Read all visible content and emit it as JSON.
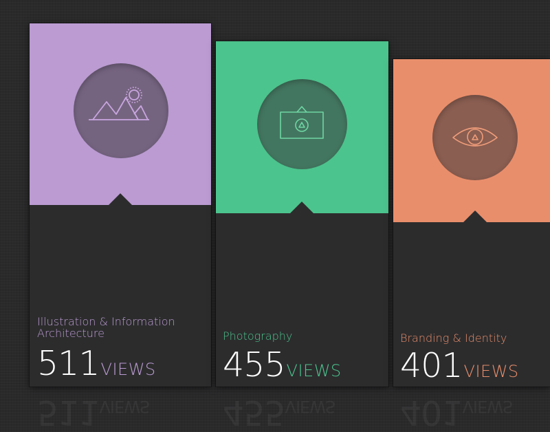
{
  "cards": [
    {
      "title": "Illustration & Information Architecture",
      "count": "511",
      "views_label": "VIEWS",
      "accent": "#bb9bd2",
      "icon": "landscape-icon"
    },
    {
      "title": "Photography",
      "count": "455",
      "views_label": "VIEWS",
      "accent": "#4cc48d",
      "icon": "camera-icon"
    },
    {
      "title": "Branding & Identity",
      "count": "401",
      "views_label": "VIEWS",
      "accent": "#e98e6b",
      "icon": "eye-icon"
    }
  ]
}
